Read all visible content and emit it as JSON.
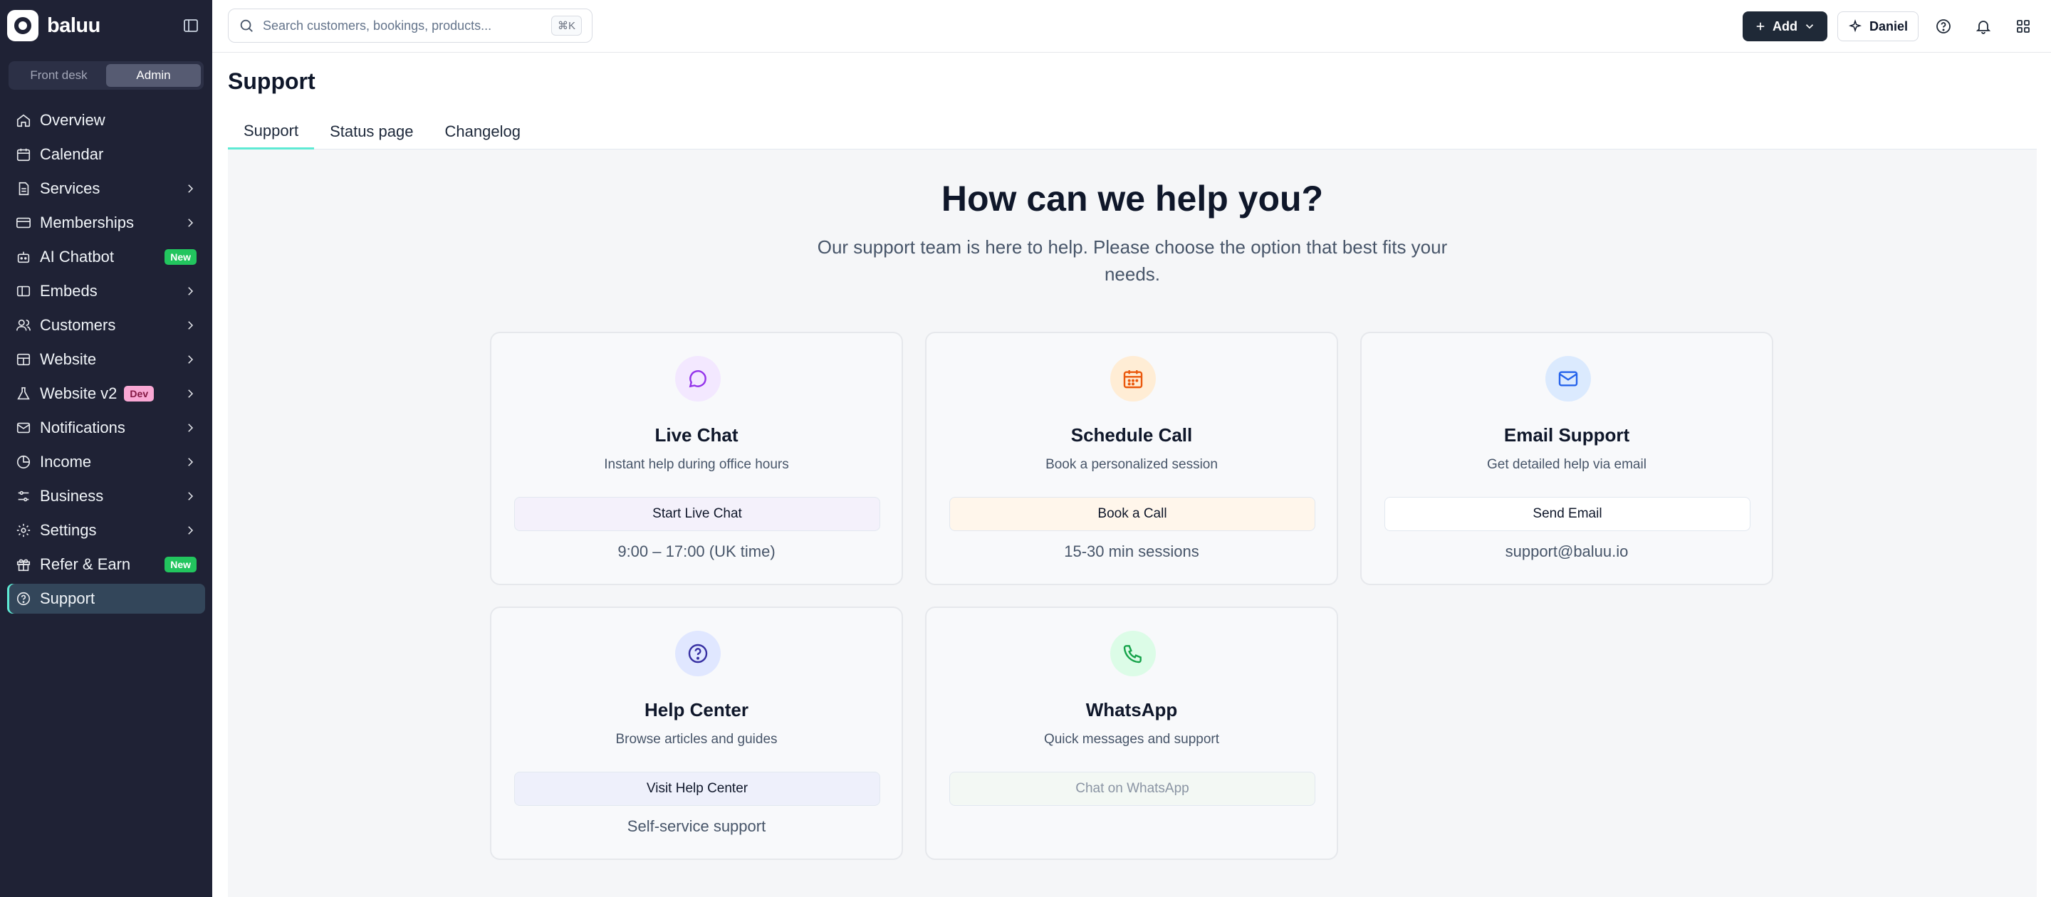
{
  "brand": {
    "name": "baluu"
  },
  "mode_toggle": {
    "front_desk": "Front desk",
    "admin": "Admin"
  },
  "sidebar": {
    "items": [
      {
        "label": "Overview"
      },
      {
        "label": "Calendar"
      },
      {
        "label": "Services"
      },
      {
        "label": "Memberships"
      },
      {
        "label": "AI Chatbot",
        "badge": "New"
      },
      {
        "label": "Embeds"
      },
      {
        "label": "Customers"
      },
      {
        "label": "Website"
      },
      {
        "label": "Website v2",
        "badge": "Dev"
      },
      {
        "label": "Notifications"
      },
      {
        "label": "Income"
      },
      {
        "label": "Business"
      },
      {
        "label": "Settings"
      },
      {
        "label": "Refer & Earn",
        "badge": "New"
      },
      {
        "label": "Support"
      }
    ]
  },
  "search": {
    "placeholder": "Search customers, bookings, products...",
    "shortcut": "⌘K"
  },
  "toolbar": {
    "add_label": "Add",
    "user_name": "Daniel"
  },
  "page": {
    "title": "Support",
    "tabs": [
      {
        "label": "Support"
      },
      {
        "label": "Status page"
      },
      {
        "label": "Changelog"
      }
    ]
  },
  "hero": {
    "title": "How can we help you?",
    "subtitle": "Our support team is here to help. Please choose the option that best fits your needs."
  },
  "cards": {
    "live_chat": {
      "title": "Live Chat",
      "desc": "Instant help during office hours",
      "button": "Start Live Chat",
      "note": "9:00 – 17:00 (UK time)",
      "icon": "chat-bubble-icon",
      "accent": "#9333ea"
    },
    "schedule_call": {
      "title": "Schedule Call",
      "desc": "Book a personalized session",
      "button": "Book a Call",
      "note": "15-30 min sessions",
      "icon": "calendar-icon",
      "accent": "#ea580c"
    },
    "email": {
      "title": "Email Support",
      "desc": "Get detailed help via email",
      "button": "Send Email",
      "note": "support@baluu.io",
      "icon": "mail-icon",
      "accent": "#2563eb"
    },
    "help_center": {
      "title": "Help Center",
      "desc": "Browse articles and guides",
      "button": "Visit Help Center",
      "note": "Self-service support",
      "icon": "question-circle-icon",
      "accent": "#3730a3"
    },
    "whatsapp": {
      "title": "WhatsApp",
      "desc": "Quick messages and support",
      "button": "Chat on WhatsApp",
      "icon": "phone-icon",
      "accent": "#16a34a"
    }
  },
  "colors": {
    "sidebar_bg": "#1f2235",
    "active_accent": "#5eead4",
    "new_badge": "#22c55e"
  }
}
